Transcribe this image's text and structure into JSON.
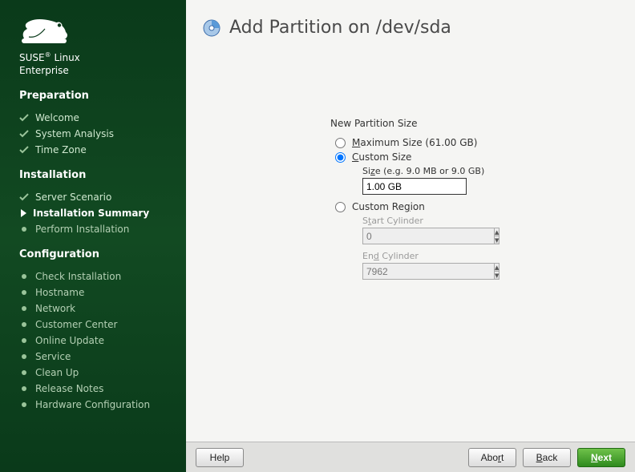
{
  "brand": {
    "line1": "SUSE",
    "line2": "Linux",
    "line3": "Enterprise"
  },
  "sidebar": {
    "section1": "Preparation",
    "prep": [
      "Welcome",
      "System Analysis",
      "Time Zone"
    ],
    "section2": "Installation",
    "inst": [
      "Server Scenario",
      "Installation Summary",
      "Perform Installation"
    ],
    "section3": "Configuration",
    "conf": [
      "Check Installation",
      "Hostname",
      "Network",
      "Customer Center",
      "Online Update",
      "Service",
      "Clean Up",
      "Release Notes",
      "Hardware Configuration"
    ]
  },
  "title": "Add Partition on /dev/sda",
  "form": {
    "group_label": "New Partition Size",
    "max_label_pre": "M",
    "max_label_post": "aximum Size (61.00 GB)",
    "custom_label_pre": "C",
    "custom_label_post": "ustom Size",
    "size_label_pre": "Si",
    "size_label_u": "z",
    "size_label_post": "e (e.g. 9.0 MB or 9.0 GB)",
    "size_value": "1.00 GB",
    "region_label_pre": "Custom Re",
    "region_label_u": "g",
    "region_label_post": "ion",
    "start_label_pre": "S",
    "start_label_u": "t",
    "start_label_post": "art Cylinder",
    "start_value": "0",
    "end_label_pre": "En",
    "end_label_u": "d",
    "end_label_post": " Cylinder",
    "end_value": "7962"
  },
  "buttons": {
    "help": "Help",
    "abort_pre": "Abo",
    "abort_u": "r",
    "abort_post": "t",
    "back_u": "B",
    "back_post": "ack",
    "next_u": "N",
    "next_post": "ext"
  }
}
